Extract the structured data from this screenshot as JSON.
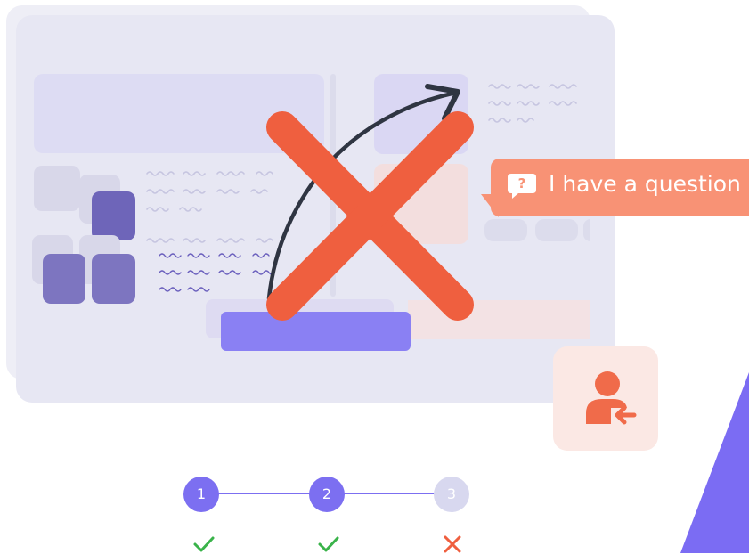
{
  "question_bubble": {
    "text": "I have a question",
    "icon": "question-chat-icon"
  },
  "agent_card": {
    "icon": "agent-transfer-icon"
  },
  "steps": [
    {
      "number": "1",
      "status": "success"
    },
    {
      "number": "2",
      "status": "success"
    },
    {
      "number": "3",
      "status": "failed"
    }
  ],
  "colors": {
    "accent": "#7c6ff1",
    "error": "#ef5f3f",
    "success": "#3ab34a",
    "bubble": "#f89275"
  }
}
